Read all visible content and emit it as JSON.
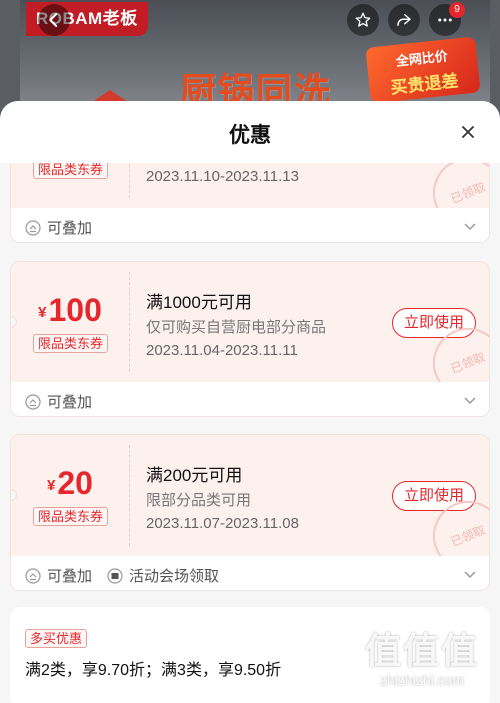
{
  "banner": {
    "brand": "ROBAM老板",
    "promo_text": "厨锅同洗",
    "badge_line1": "全网比价",
    "badge_line2": "买贵退差",
    "notification_count": "9"
  },
  "sheet": {
    "title": "优惠"
  },
  "coupons": [
    {
      "amount": "",
      "tag": "限品类东券",
      "condition": "",
      "description": "",
      "date_range": "2023.11.10-2023.11.13",
      "stamp": "已领取",
      "stack_label": "可叠加",
      "venue_label": ""
    },
    {
      "currency": "¥",
      "amount": "100",
      "tag": "限品类东券",
      "condition": "满1000元可用",
      "description": "仅可购买自营厨电部分商品",
      "date_range": "2023.11.04-2023.11.11",
      "button": "立即使用",
      "stamp": "已领取",
      "stack_label": "可叠加",
      "venue_label": ""
    },
    {
      "currency": "¥",
      "amount": "20",
      "tag": "限品类东券",
      "condition": "满200元可用",
      "description": "限部分品类可用",
      "date_range": "2023.11.07-2023.11.08",
      "button": "立即使用",
      "stamp": "已领取",
      "stack_label": "可叠加",
      "venue_label": "活动会场领取"
    }
  ],
  "multi_buy": {
    "tag": "多买优惠",
    "text": "满2类，享9.70折；满3类，享9.50折"
  },
  "watermark": {
    "logo": "值值值",
    "url": "zhizhizhi.com"
  },
  "colors": {
    "accent": "#e5272d",
    "coupon_bg": "#fdf1ee",
    "sheet_bg": "#f6f6f6"
  }
}
